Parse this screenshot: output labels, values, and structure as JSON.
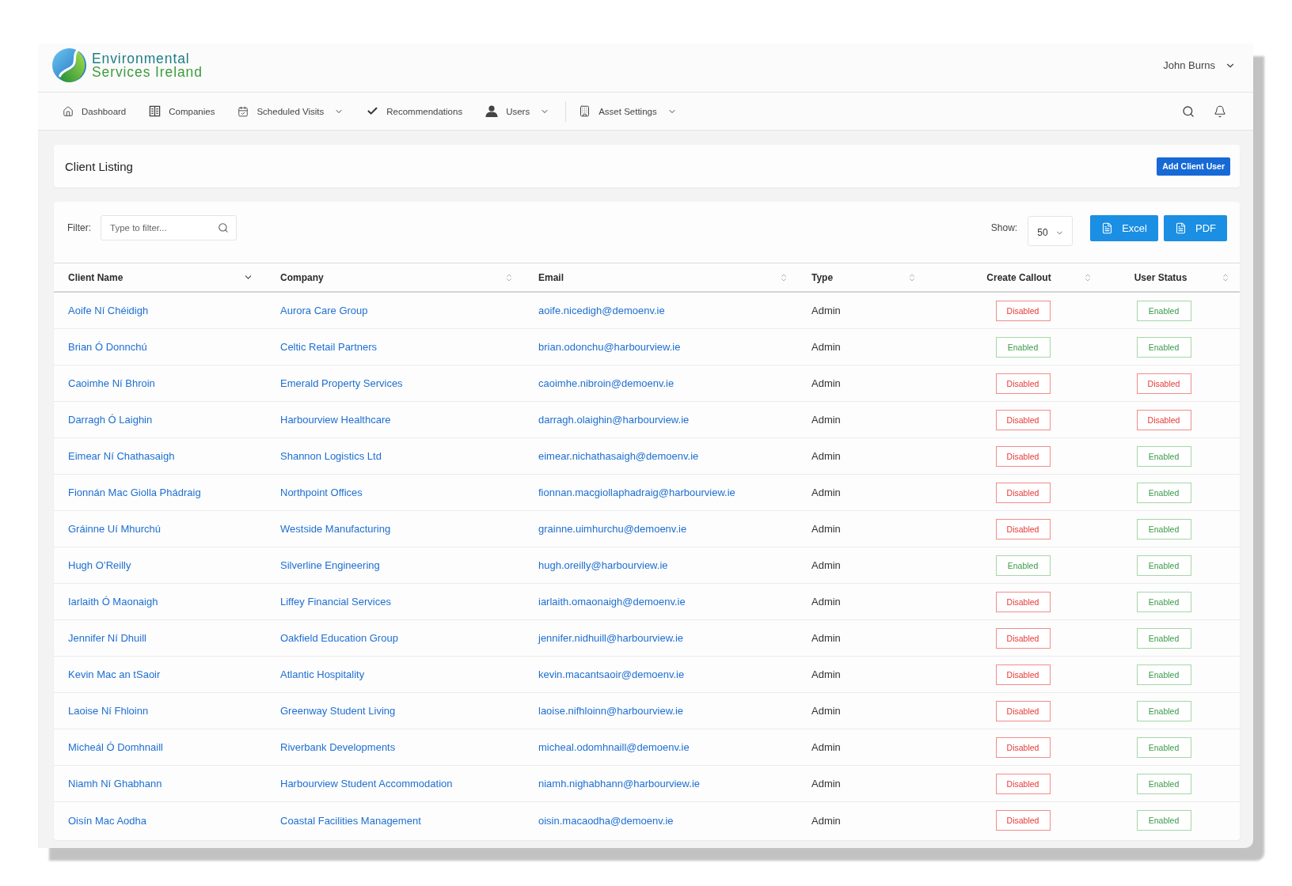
{
  "header": {
    "logo": {
      "line_1": "Environmental",
      "line_2": "Services Ireland"
    },
    "user_menu": {
      "name": "John Burns"
    }
  },
  "nav": {
    "groups": [
      {
        "items": [
          {
            "kind": "dashboard",
            "label": "Dashboard",
            "has_dropdown": false
          },
          {
            "kind": "companies",
            "label": "Companies",
            "has_dropdown": false
          },
          {
            "kind": "visits",
            "label": "Scheduled Visits",
            "has_dropdown": true
          },
          {
            "kind": "recommendations",
            "label": "Recommendations",
            "has_dropdown": false
          },
          {
            "kind": "users",
            "label": "Users",
            "has_dropdown": true
          }
        ]
      },
      {
        "items": [
          {
            "kind": "assets",
            "label": "Asset Settings",
            "has_dropdown": true
          }
        ]
      }
    ]
  },
  "page_header": {
    "title": "Client Listing",
    "action_button": "Add Client User"
  },
  "toolbar": {
    "filter": {
      "label": "Filter:",
      "placeholder": "Type to filter..."
    },
    "show": {
      "label": "Show:",
      "value": "50"
    },
    "export_buttons": [
      "Excel",
      "PDF"
    ]
  },
  "table": {
    "columns": [
      {
        "label": "Client Name",
        "sorted": true
      },
      {
        "label": "Company",
        "sorted": false
      },
      {
        "label": "Email",
        "sorted": false
      },
      {
        "label": "Type",
        "sorted": false
      },
      {
        "label": "Create Callout",
        "sorted": false
      },
      {
        "label": "User Status",
        "sorted": false
      }
    ],
    "rows": [
      {
        "client_name": "Aoife Ní Chéidigh",
        "company": "Aurora Care Group",
        "email": "aoife.nicedigh@demoenv.ie",
        "type": "Admin",
        "create_callout": {
          "label": "Disabled",
          "enabled": false
        },
        "user_status": {
          "label": "Enabled",
          "enabled": true
        }
      },
      {
        "client_name": "Brian Ó Donnchú",
        "company": "Celtic Retail Partners",
        "email": "brian.odonchu@harbourview.ie",
        "type": "Admin",
        "create_callout": {
          "label": "Enabled",
          "enabled": true
        },
        "user_status": {
          "label": "Enabled",
          "enabled": true
        }
      },
      {
        "client_name": "Caoimhe Ní Bhroin",
        "company": "Emerald Property Services",
        "email": "caoimhe.nibroin@demoenv.ie",
        "type": "Admin",
        "create_callout": {
          "label": "Disabled",
          "enabled": false
        },
        "user_status": {
          "label": "Disabled",
          "enabled": false
        }
      },
      {
        "client_name": "Darragh Ó Laighin",
        "company": "Harbourview Healthcare",
        "email": "darragh.olaighin@harbourview.ie",
        "type": "Admin",
        "create_callout": {
          "label": "Disabled",
          "enabled": false
        },
        "user_status": {
          "label": "Disabled",
          "enabled": false
        }
      },
      {
        "client_name": "Eimear Ní Chathasaigh",
        "company": "Shannon Logistics Ltd",
        "email": "eimear.nichathasaigh@demoenv.ie",
        "type": "Admin",
        "create_callout": {
          "label": "Disabled",
          "enabled": false
        },
        "user_status": {
          "label": "Enabled",
          "enabled": true
        }
      },
      {
        "client_name": "Fionnán Mac Giolla Phádraig",
        "company": "Northpoint Offices",
        "email": "fionnan.macgiollaphadraig@harbourview.ie",
        "type": "Admin",
        "create_callout": {
          "label": "Disabled",
          "enabled": false
        },
        "user_status": {
          "label": "Enabled",
          "enabled": true
        }
      },
      {
        "client_name": "Gráinne Uí Mhurchú",
        "company": "Westside Manufacturing",
        "email": "grainne.uimhurchu@demoenv.ie",
        "type": "Admin",
        "create_callout": {
          "label": "Disabled",
          "enabled": false
        },
        "user_status": {
          "label": "Enabled",
          "enabled": true
        }
      },
      {
        "client_name": "Hugh O’Reilly",
        "company": "Silverline Engineering",
        "email": "hugh.oreilly@harbourview.ie",
        "type": "Admin",
        "create_callout": {
          "label": "Enabled",
          "enabled": true
        },
        "user_status": {
          "label": "Enabled",
          "enabled": true
        }
      },
      {
        "client_name": "Iarlaith Ó Maonaigh",
        "company": "Liffey Financial Services",
        "email": "iarlaith.omaonaigh@demoenv.ie",
        "type": "Admin",
        "create_callout": {
          "label": "Disabled",
          "enabled": false
        },
        "user_status": {
          "label": "Enabled",
          "enabled": true
        }
      },
      {
        "client_name": "Jennifer Ní Dhuill",
        "company": "Oakfield Education Group",
        "email": "jennifer.nidhuill@harbourview.ie",
        "type": "Admin",
        "create_callout": {
          "label": "Disabled",
          "enabled": false
        },
        "user_status": {
          "label": "Enabled",
          "enabled": true
        }
      },
      {
        "client_name": "Kevin Mac an tSaoir",
        "company": "Atlantic Hospitality",
        "email": "kevin.macantsaoir@demoenv.ie",
        "type": "Admin",
        "create_callout": {
          "label": "Disabled",
          "enabled": false
        },
        "user_status": {
          "label": "Enabled",
          "enabled": true
        }
      },
      {
        "client_name": "Laoise Ní Fhloinn",
        "company": "Greenway Student Living",
        "email": "laoise.nifhloinn@harbourview.ie",
        "type": "Admin",
        "create_callout": {
          "label": "Disabled",
          "enabled": false
        },
        "user_status": {
          "label": "Enabled",
          "enabled": true
        }
      },
      {
        "client_name": "Micheál Ó Domhnaill",
        "company": "Riverbank Developments",
        "email": "micheal.odomhnaill@demoenv.ie",
        "type": "Admin",
        "create_callout": {
          "label": "Disabled",
          "enabled": false
        },
        "user_status": {
          "label": "Enabled",
          "enabled": true
        }
      },
      {
        "client_name": "Niamh Ní Ghabhann",
        "company": "Harbourview Student Accommodation",
        "email": "niamh.nighabhann@harbourview.ie",
        "type": "Admin",
        "create_callout": {
          "label": "Disabled",
          "enabled": false
        },
        "user_status": {
          "label": "Enabled",
          "enabled": true
        }
      },
      {
        "client_name": "Oisín Mac Aodha",
        "company": "Coastal Facilities Management",
        "email": "oisin.macaodha@demoenv.ie",
        "type": "Admin",
        "create_callout": {
          "label": "Disabled",
          "enabled": false
        },
        "user_status": {
          "label": "Enabled",
          "enabled": true
        }
      }
    ]
  }
}
